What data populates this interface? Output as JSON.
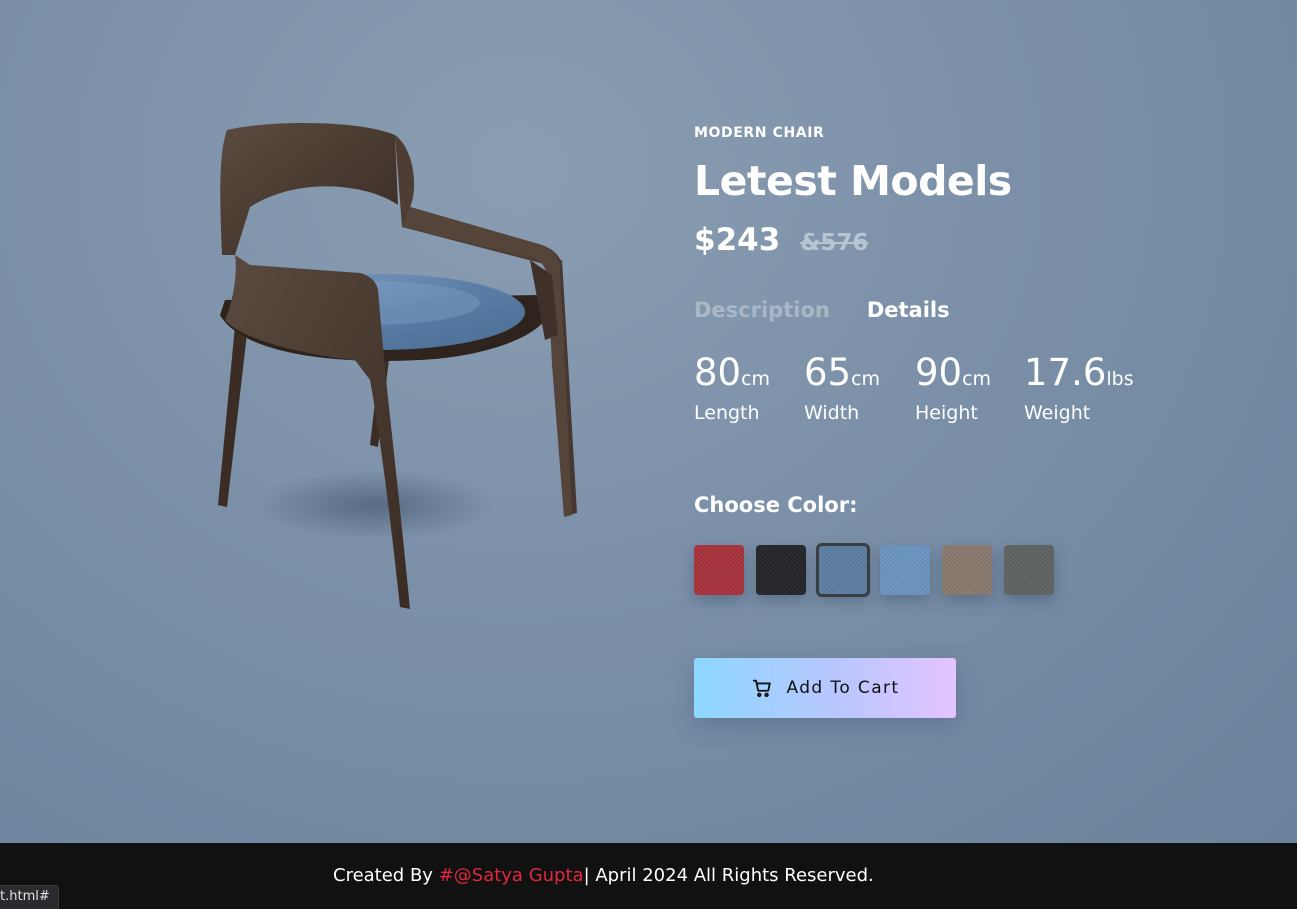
{
  "product": {
    "subtitle": "MODERN CHAIR",
    "title": "Letest Models",
    "price_now": "$243",
    "price_old": "&576",
    "image_icon": "chair-image"
  },
  "tabs": [
    {
      "label": "Description",
      "active": false
    },
    {
      "label": "Details",
      "active": true
    }
  ],
  "dimensions": [
    {
      "value": "80",
      "unit": "cm",
      "label": "Length"
    },
    {
      "value": "65",
      "unit": "cm",
      "label": "Width"
    },
    {
      "value": "90",
      "unit": "cm",
      "label": "Height"
    },
    {
      "value": "17.6",
      "unit": "lbs",
      "label": "Weight"
    }
  ],
  "colors": {
    "heading": "Choose Color:",
    "options": [
      {
        "name": "red-fabric",
        "hex": "#a8323c",
        "selected": false
      },
      {
        "name": "black-fabric",
        "hex": "#242528",
        "selected": false
      },
      {
        "name": "blue-velvet",
        "hex": "#5d7fa3",
        "selected": true
      },
      {
        "name": "light-blue-fabric",
        "hex": "#6b95c0",
        "selected": false
      },
      {
        "name": "tan-fabric",
        "hex": "#8a7a70",
        "selected": false
      },
      {
        "name": "grey-fabric",
        "hex": "#5f6463",
        "selected": false
      }
    ]
  },
  "cart": {
    "label": "Add To Cart",
    "icon": "cart-icon"
  },
  "footer": {
    "prefix": "Created By ",
    "author": "#@Satya Gupta",
    "suffix": "| April 2024 All Rights Reserved."
  },
  "status_bar": {
    "url": "t.html#"
  },
  "theme": {
    "background": "#7b90a8",
    "footer_bg": "#111111",
    "author_color": "#e3263f"
  }
}
